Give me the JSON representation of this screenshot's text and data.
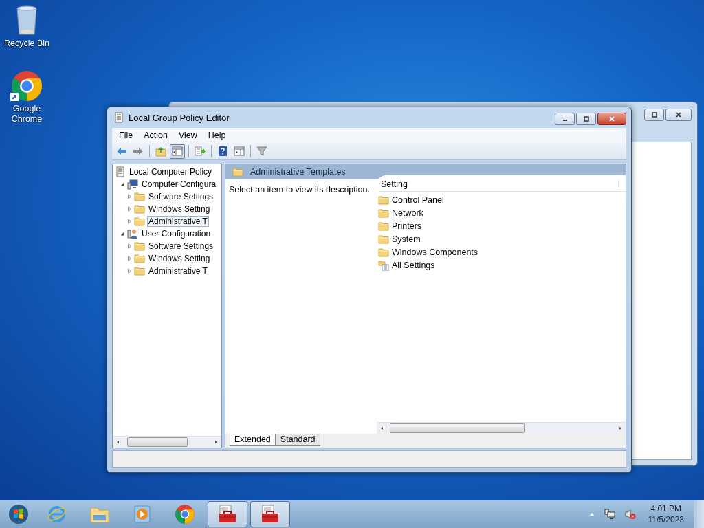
{
  "desktop_icons": [
    {
      "kind": "recycle",
      "label": "Recycle Bin"
    },
    {
      "kind": "chrome",
      "label": "Google Chrome"
    }
  ],
  "window": {
    "title": "Local Group Policy Editor",
    "menu": [
      "File",
      "Action",
      "View",
      "Help"
    ],
    "toolbar": [
      {
        "kind": "back",
        "pressed": false
      },
      {
        "kind": "forward",
        "pressed": false
      },
      {
        "kind": "sep"
      },
      {
        "kind": "up",
        "pressed": false
      },
      {
        "kind": "tree",
        "pressed": true
      },
      {
        "kind": "sep"
      },
      {
        "kind": "export",
        "pressed": false
      },
      {
        "kind": "sep"
      },
      {
        "kind": "help",
        "pressed": false
      },
      {
        "kind": "panel",
        "pressed": false
      },
      {
        "kind": "sep"
      },
      {
        "kind": "filter",
        "pressed": false
      }
    ],
    "tree": [
      {
        "kind": "policy",
        "label": "Local Computer Policy",
        "selected": false,
        "children": [
          {
            "kind": "computer",
            "label": "Computer Configura",
            "expanded": true,
            "selected": false,
            "children": [
              {
                "kind": "folder",
                "label": "Software Settings",
                "expanded": false,
                "selected": false
              },
              {
                "kind": "folder",
                "label": "Windows Setting",
                "expanded": false,
                "selected": false
              },
              {
                "kind": "folder",
                "label": "Administrative T",
                "expanded": false,
                "selected": true
              }
            ]
          },
          {
            "kind": "user",
            "label": "User Configuration",
            "expanded": true,
            "selected": false,
            "children": [
              {
                "kind": "folder",
                "label": "Software Settings",
                "expanded": false,
                "selected": false
              },
              {
                "kind": "folder",
                "label": "Windows Setting",
                "expanded": false,
                "selected": false
              },
              {
                "kind": "folder",
                "label": "Administrative T",
                "expanded": false,
                "selected": false
              }
            ]
          }
        ]
      }
    ],
    "details": {
      "header": "Administrative Templates",
      "description": "Select an item to view its description.",
      "column": "Setting",
      "items": [
        {
          "kind": "folder",
          "label": "Control Panel"
        },
        {
          "kind": "folder",
          "label": "Network"
        },
        {
          "kind": "folder",
          "label": "Printers"
        },
        {
          "kind": "folder",
          "label": "System"
        },
        {
          "kind": "folder",
          "label": "Windows Components"
        },
        {
          "kind": "settings",
          "label": "All Settings"
        }
      ]
    },
    "tabs": [
      {
        "label": "Extended",
        "selected": true
      },
      {
        "label": "Standard",
        "selected": false
      }
    ]
  },
  "taskbar": {
    "items": [
      {
        "kind": "ie",
        "active": false
      },
      {
        "kind": "explorer",
        "active": false
      },
      {
        "kind": "media",
        "active": false
      },
      {
        "kind": "chrome",
        "active": false
      },
      {
        "kind": "toolbox",
        "active": true
      },
      {
        "kind": "toolbox",
        "active": true
      }
    ],
    "time": "4:01 PM",
    "date": "11/5/2023"
  }
}
